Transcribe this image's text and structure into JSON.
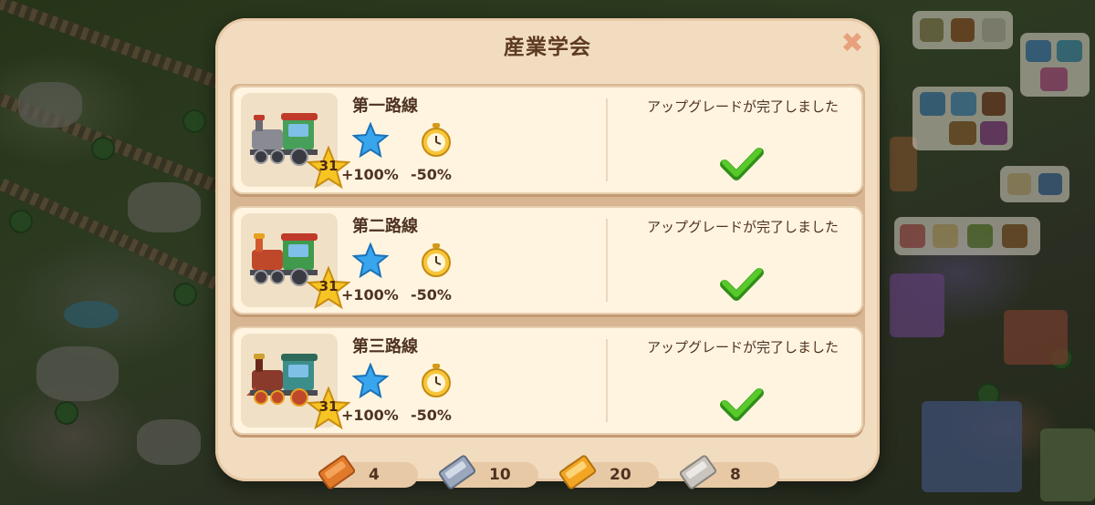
{
  "dialog": {
    "title": "産業学会",
    "close_icon": "close-x-icon"
  },
  "lines": [
    {
      "name": "第一路線",
      "level": "31",
      "star_bonus": "+100%",
      "time_bonus": "-50%",
      "status": "アップグレードが完了しました",
      "train_color": "#46a05a",
      "status_icon": "checkmark-icon"
    },
    {
      "name": "第二路線",
      "level": "31",
      "star_bonus": "+100%",
      "time_bonus": "-50%",
      "status": "アップグレードが完了しました",
      "train_color": "#3f9a4c",
      "status_icon": "checkmark-icon"
    },
    {
      "name": "第三路線",
      "level": "31",
      "star_bonus": "+100%",
      "time_bonus": "-50%",
      "status": "アップグレードが完了しました",
      "train_color": "#3b8e8a",
      "status_icon": "checkmark-icon"
    }
  ],
  "resources": [
    {
      "name": "bronze-ingot",
      "value": "4",
      "color": "#e07a2a"
    },
    {
      "name": "silver-ingot",
      "value": "10",
      "color": "#9aa7bd"
    },
    {
      "name": "gold-ingot",
      "value": "20",
      "color": "#f2a623"
    },
    {
      "name": "platinum-ingot",
      "value": "8",
      "color": "#c9c5be"
    }
  ]
}
